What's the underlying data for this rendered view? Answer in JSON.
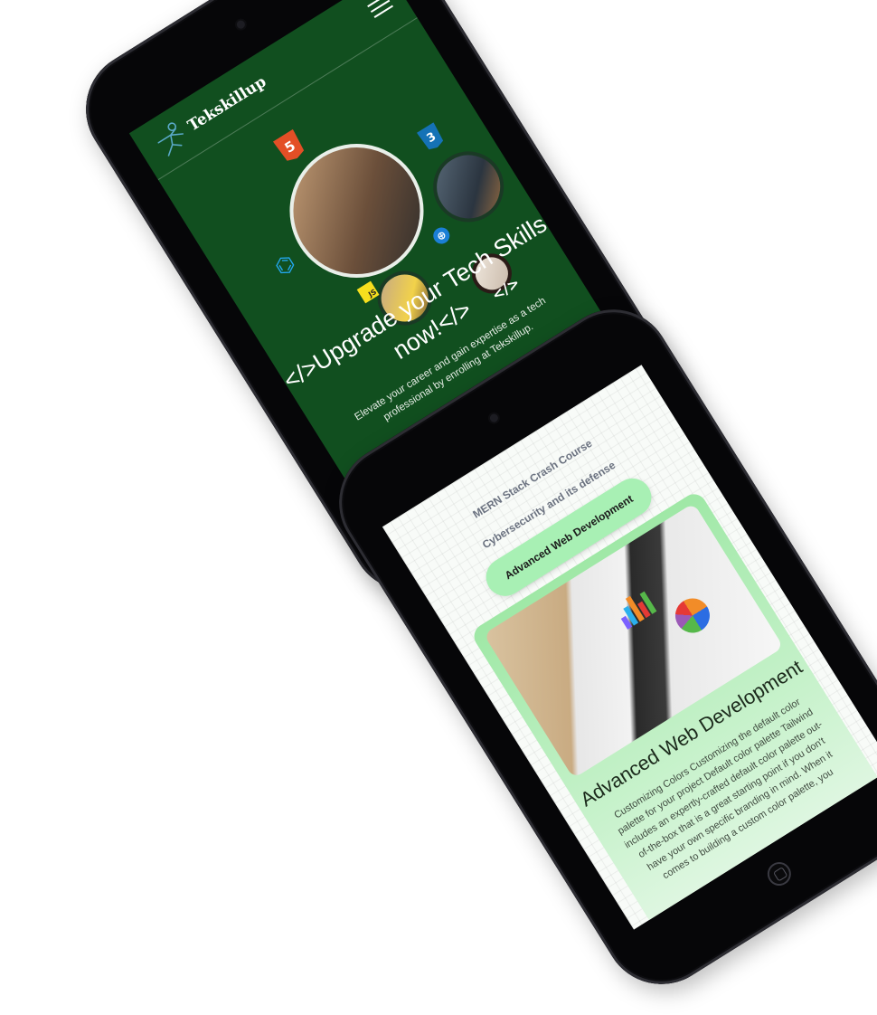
{
  "tablet_left": {
    "brand": {
      "name": "Tekskillup",
      "logo_icon": "runner-logo-icon"
    },
    "menu_icon": "hamburger-menu-icon",
    "tech_icons": [
      "html5-icon",
      "css3-icon",
      "vscode-icon",
      "javascript-icon",
      "globe-icon",
      "code-brackets-icon"
    ],
    "icon_glyphs": {
      "html": "5",
      "css": "3",
      "vs": "⌬",
      "js": "JS",
      "globe": "⊕",
      "code": "</>"
    },
    "hero": {
      "title": "</>Upgrade your Tech Skills now!</>",
      "subtitle": "Elevate your career and gain expertise as a tech professional by enrolling at Tekskillup."
    },
    "colors": {
      "background": "#114f1f",
      "text": "#ffffff"
    }
  },
  "tablet_right": {
    "course_tabs": [
      {
        "label": "MERN Stack Crash Course",
        "active": false
      },
      {
        "label": "Cybersecurity and its defense",
        "active": false
      },
      {
        "label": "Advanced Web Development",
        "active": true
      }
    ],
    "course_card": {
      "title": "Advanced Web Development",
      "description": "Customizing Colors Customizing the default color palette for your project Default color palette Tailwind includes an expertly-crafted default color palette out-of-the-box that is a great starting point if you don't have your own specific branding in mind. When it comes to building a custom color palette, you"
    },
    "colors": {
      "tab_active": "#a8f0b4",
      "card": "#9fe8a6"
    }
  }
}
